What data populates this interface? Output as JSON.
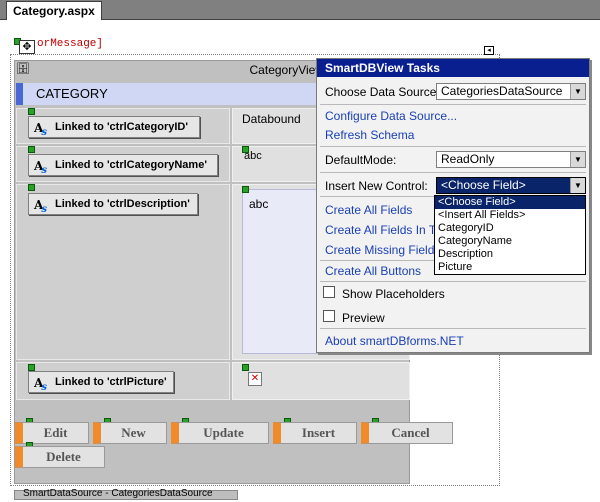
{
  "document": {
    "tab_title": "Category.aspx",
    "error_message_label": "orMessage]"
  },
  "control": {
    "title": "CategoryView",
    "header": "CATEGORY",
    "rows": [
      {
        "button": "Linked to 'ctrlCategoryID'",
        "value": "Databound"
      },
      {
        "button": "Linked to 'ctrlCategoryName'",
        "value": "abc"
      },
      {
        "button": "Linked to 'ctrlDescription'",
        "value": "abc"
      },
      {
        "button": "Linked to 'ctrlPicture'",
        "value": ""
      }
    ],
    "icon_label": "A",
    "action_buttons": [
      "Edit",
      "New",
      "Update",
      "Insert",
      "Cancel",
      "Delete"
    ]
  },
  "tasks": {
    "title": "SmartDBView Tasks",
    "data_source_label": "Choose Data Source:",
    "data_source_value": "CategoriesDataSource",
    "configure_link": "Configure Data Source...",
    "refresh_link": "Refresh Schema",
    "default_mode_label": "DefaultMode:",
    "default_mode_value": "ReadOnly",
    "insert_control_label": "Insert New Control:",
    "insert_control_value": "<Choose Field>",
    "links": [
      "Create All Fields",
      "Create All Fields In Tab",
      "Create Missing Fields",
      "Create All Buttons"
    ],
    "show_placeholders": "Show Placeholders",
    "preview": "Preview",
    "about": "About smartDBforms.NET",
    "dropdown_options": [
      "<Choose Field>",
      "<Insert All Fields>",
      "CategoryID",
      "CategoryName",
      "Description",
      "Picture"
    ]
  },
  "bottom_strip_text": "SmartDataSource - CategoriesDataSource",
  "colors": {
    "tasks_title_bg": "#0a1f8f",
    "header_accent": "#4a67d6",
    "button_accent": "#f08a2a",
    "link": "#1a3fb5",
    "error_text": "#c00000"
  }
}
